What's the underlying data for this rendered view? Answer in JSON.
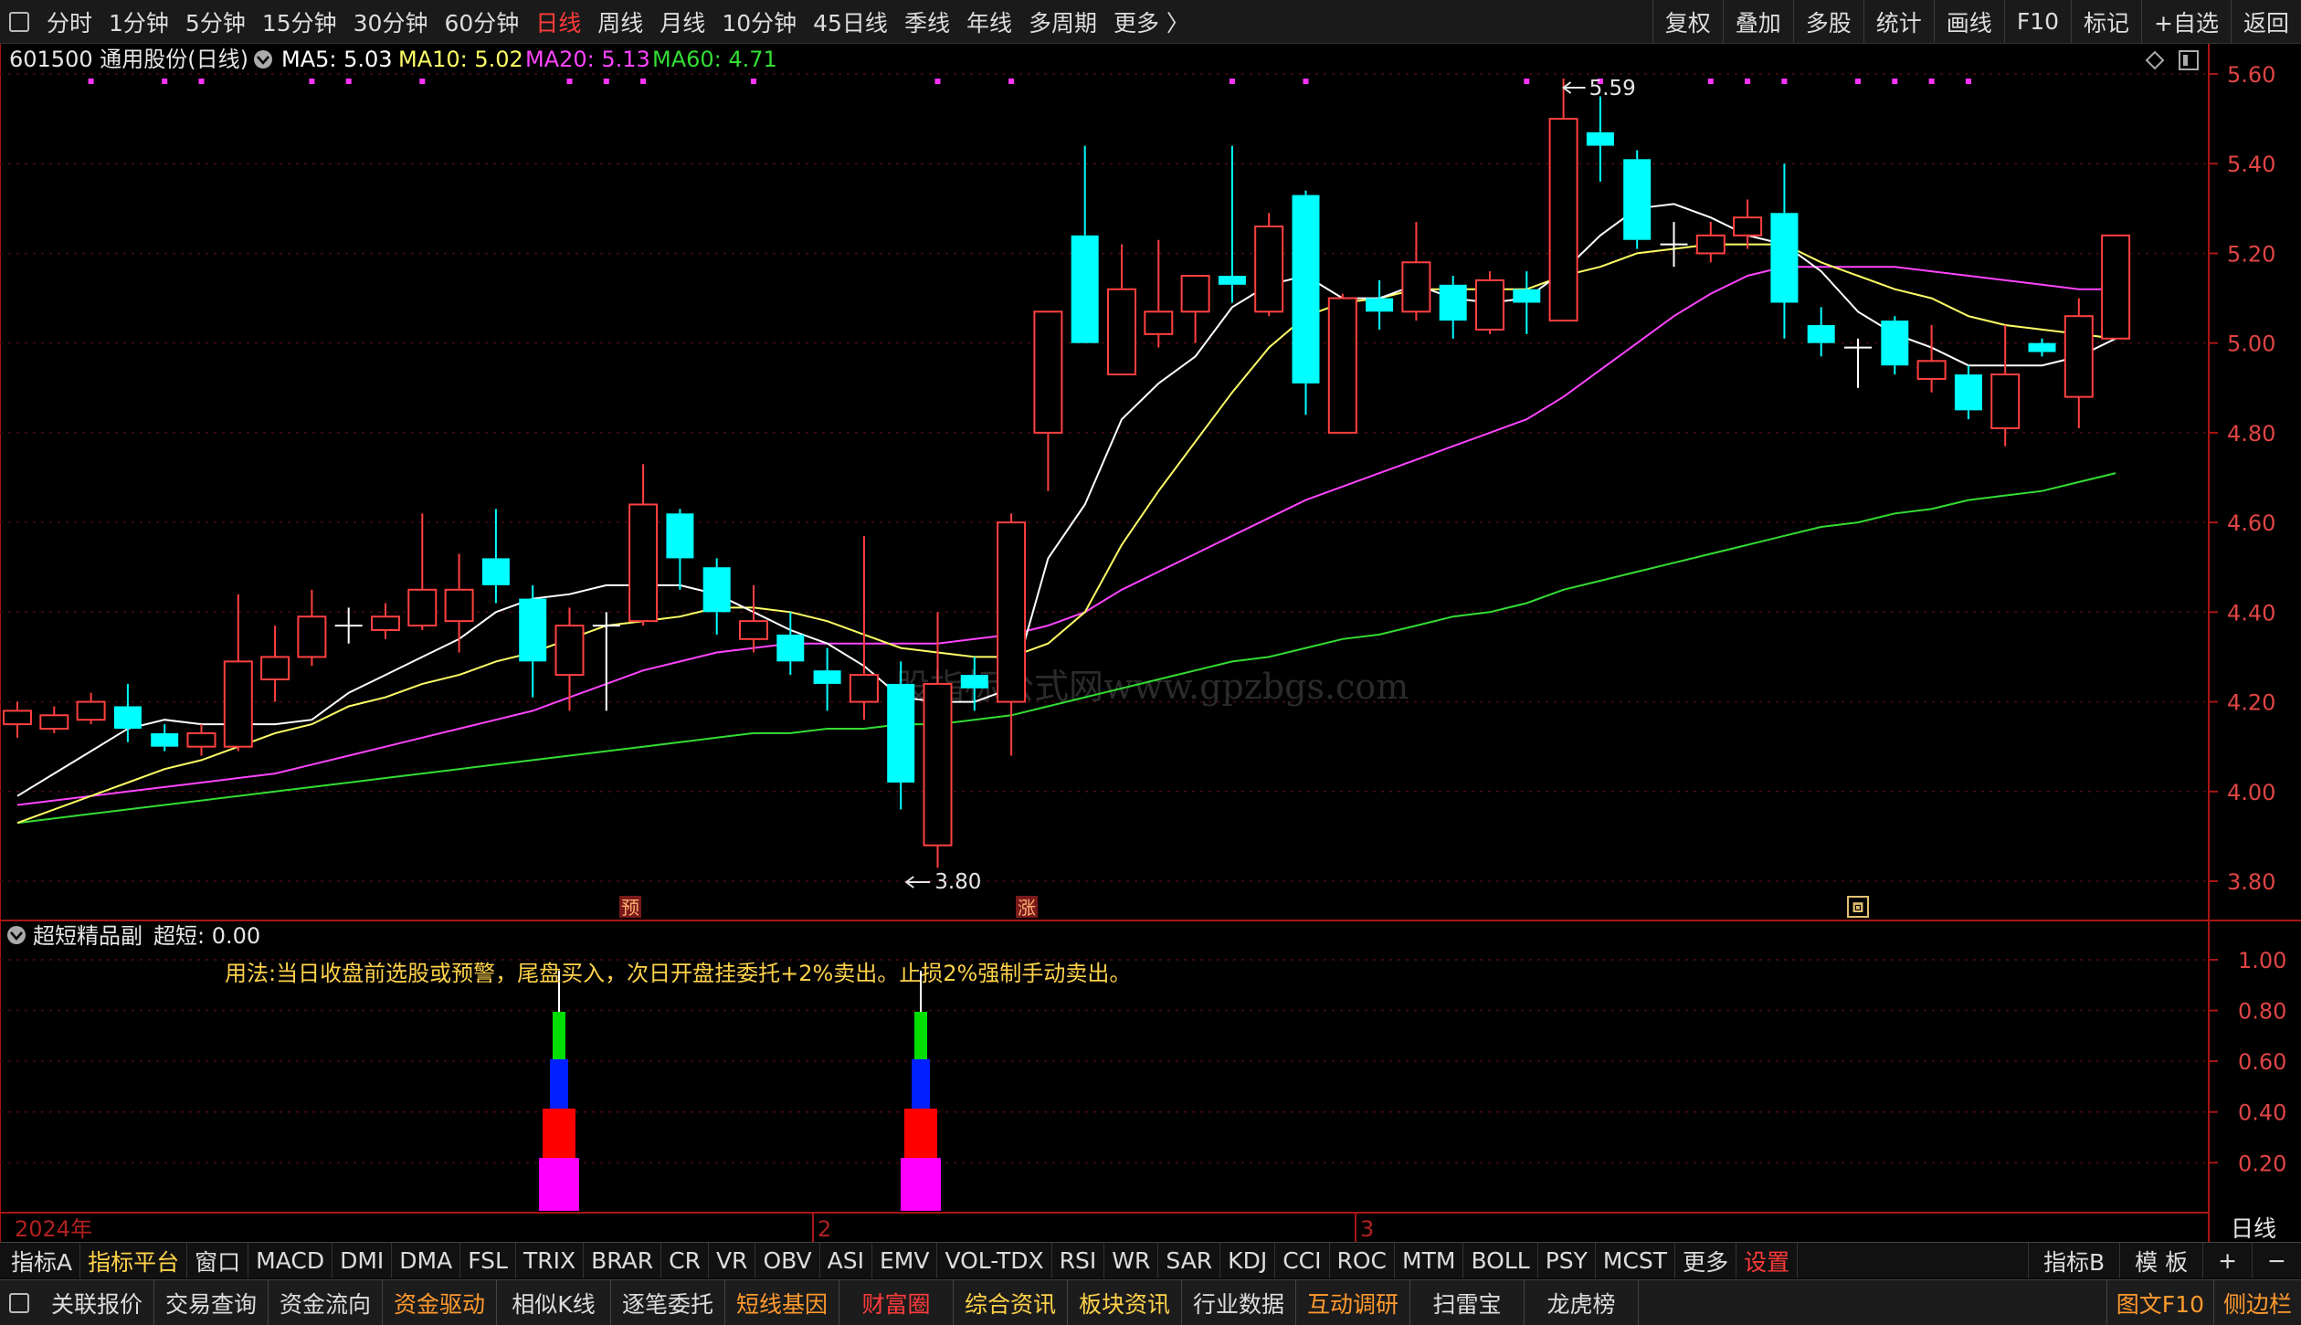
{
  "top_menu": {
    "periods": [
      "分时",
      "1分钟",
      "5分钟",
      "15分钟",
      "30分钟",
      "60分钟",
      "日线",
      "周线",
      "月线",
      "10分钟",
      "45日线",
      "季线",
      "年线",
      "多周期",
      "更多 〉"
    ],
    "active_period": "日线",
    "right_buttons": [
      "复权",
      "叠加",
      "多股",
      "统计",
      "画线",
      "F10",
      "标记",
      "+自选",
      "返回"
    ]
  },
  "stock": {
    "title": "601500 通用股份(日线)",
    "ma5": "MA5: 5.03",
    "ma10": "MA10: 5.02",
    "ma20": "MA20: 5.13",
    "ma60": "MA60: 4.71"
  },
  "colors": {
    "up": "#ff4040",
    "down": "#00ffff",
    "ma5": "#ffffff",
    "ma10": "#ffff66",
    "ma20": "#ff44ff",
    "ma60": "#33dd33",
    "axis": "#aa1515",
    "label": "#e04444",
    "notice": "#ffd24a"
  },
  "chart_data": {
    "type": "candlestick",
    "x_label": "2024年",
    "month_labels": [
      "2",
      "3"
    ],
    "price_axis": {
      "min": 3.8,
      "max": 5.6,
      "ticks": [
        "5.60",
        "5.40",
        "5.20",
        "5.00",
        "4.80",
        "4.60",
        "4.40",
        "4.20",
        "4.00",
        "3.80"
      ]
    },
    "high_label": "5.59",
    "low_label": "3.80",
    "markers": [
      "预",
      "涨",
      "回"
    ],
    "candles": [
      {
        "o": 4.15,
        "c": 4.18,
        "h": 4.2,
        "l": 4.12
      },
      {
        "o": 4.14,
        "c": 4.17,
        "h": 4.19,
        "l": 4.13
      },
      {
        "o": 4.16,
        "c": 4.2,
        "h": 4.22,
        "l": 4.15
      },
      {
        "o": 4.19,
        "c": 4.14,
        "h": 4.24,
        "l": 4.11
      },
      {
        "o": 4.13,
        "c": 4.1,
        "h": 4.15,
        "l": 4.09
      },
      {
        "o": 4.1,
        "c": 4.13,
        "h": 4.15,
        "l": 4.08
      },
      {
        "o": 4.1,
        "c": 4.29,
        "h": 4.44,
        "l": 4.09
      },
      {
        "o": 4.25,
        "c": 4.3,
        "h": 4.37,
        "l": 4.2
      },
      {
        "o": 4.3,
        "c": 4.39,
        "h": 4.45,
        "l": 4.28
      },
      {
        "o": 4.37,
        "c": 4.37,
        "h": 4.41,
        "l": 4.33
      },
      {
        "o": 4.36,
        "c": 4.39,
        "h": 4.42,
        "l": 4.34
      },
      {
        "o": 4.37,
        "c": 4.45,
        "h": 4.62,
        "l": 4.36
      },
      {
        "o": 4.38,
        "c": 4.45,
        "h": 4.53,
        "l": 4.31
      },
      {
        "o": 4.52,
        "c": 4.46,
        "h": 4.63,
        "l": 4.42
      },
      {
        "o": 4.43,
        "c": 4.29,
        "h": 4.46,
        "l": 4.21
      },
      {
        "o": 4.26,
        "c": 4.37,
        "h": 4.41,
        "l": 4.18
      },
      {
        "o": 4.37,
        "c": 4.37,
        "h": 4.4,
        "l": 4.18
      },
      {
        "o": 4.38,
        "c": 4.64,
        "h": 4.73,
        "l": 4.37
      },
      {
        "o": 4.62,
        "c": 4.52,
        "h": 4.63,
        "l": 4.45
      },
      {
        "o": 4.5,
        "c": 4.4,
        "h": 4.52,
        "l": 4.35
      },
      {
        "o": 4.34,
        "c": 4.38,
        "h": 4.46,
        "l": 4.31
      },
      {
        "o": 4.35,
        "c": 4.29,
        "h": 4.4,
        "l": 4.26
      },
      {
        "o": 4.27,
        "c": 4.24,
        "h": 4.32,
        "l": 4.18
      },
      {
        "o": 4.2,
        "c": 4.26,
        "h": 4.57,
        "l": 4.16
      },
      {
        "o": 4.24,
        "c": 4.02,
        "h": 4.29,
        "l": 3.96
      },
      {
        "o": 3.88,
        "c": 4.24,
        "h": 4.4,
        "l": 3.83
      },
      {
        "o": 4.26,
        "c": 4.23,
        "h": 4.3,
        "l": 4.18
      },
      {
        "o": 4.2,
        "c": 4.6,
        "h": 4.62,
        "l": 4.08
      },
      {
        "o": 4.8,
        "c": 5.07,
        "h": 5.07,
        "l": 4.67
      },
      {
        "o": 5.24,
        "c": 5.0,
        "h": 5.44,
        "l": 5.0
      },
      {
        "o": 4.93,
        "c": 5.12,
        "h": 5.22,
        "l": 4.93
      },
      {
        "o": 5.02,
        "c": 5.07,
        "h": 5.23,
        "l": 4.99
      },
      {
        "o": 5.07,
        "c": 5.15,
        "h": 5.15,
        "l": 5.0
      },
      {
        "o": 5.15,
        "c": 5.13,
        "h": 5.44,
        "l": 5.09
      },
      {
        "o": 5.07,
        "c": 5.26,
        "h": 5.29,
        "l": 5.06
      },
      {
        "o": 5.33,
        "c": 4.91,
        "h": 5.34,
        "l": 4.84
      },
      {
        "o": 4.8,
        "c": 5.1,
        "h": 5.11,
        "l": 4.8
      },
      {
        "o": 5.1,
        "c": 5.07,
        "h": 5.14,
        "l": 5.03
      },
      {
        "o": 5.07,
        "c": 5.18,
        "h": 5.27,
        "l": 5.05
      },
      {
        "o": 5.13,
        "c": 5.05,
        "h": 5.15,
        "l": 5.01
      },
      {
        "o": 5.03,
        "c": 5.14,
        "h": 5.16,
        "l": 5.02
      },
      {
        "o": 5.12,
        "c": 5.09,
        "h": 5.16,
        "l": 5.02
      },
      {
        "o": 5.05,
        "c": 5.5,
        "h": 5.59,
        "l": 5.05
      },
      {
        "o": 5.47,
        "c": 5.44,
        "h": 5.55,
        "l": 5.36
      },
      {
        "o": 5.41,
        "c": 5.23,
        "h": 5.43,
        "l": 5.21
      },
      {
        "o": 5.22,
        "c": 5.22,
        "h": 5.27,
        "l": 5.17
      },
      {
        "o": 5.2,
        "c": 5.24,
        "h": 5.27,
        "l": 5.18
      },
      {
        "o": 5.24,
        "c": 5.28,
        "h": 5.32,
        "l": 5.21
      },
      {
        "o": 5.29,
        "c": 5.09,
        "h": 5.4,
        "l": 5.01
      },
      {
        "o": 5.04,
        "c": 5.0,
        "h": 5.08,
        "l": 4.97
      },
      {
        "o": 4.99,
        "c": 4.99,
        "h": 5.01,
        "l": 4.9
      },
      {
        "o": 5.05,
        "c": 4.95,
        "h": 5.06,
        "l": 4.93
      },
      {
        "o": 4.92,
        "c": 4.96,
        "h": 5.04,
        "l": 4.89
      },
      {
        "o": 4.93,
        "c": 4.85,
        "h": 4.95,
        "l": 4.83
      },
      {
        "o": 4.81,
        "c": 4.93,
        "h": 5.04,
        "l": 4.77
      },
      {
        "o": 5.0,
        "c": 4.98,
        "h": 5.01,
        "l": 4.97
      },
      {
        "o": 4.88,
        "c": 5.06,
        "h": 5.1,
        "l": 4.81
      },
      {
        "o": 5.01,
        "c": 5.24,
        "h": 5.24,
        "l": 5.01
      }
    ],
    "ma5_values": [
      3.99,
      4.04,
      4.09,
      4.14,
      4.16,
      4.15,
      4.15,
      4.15,
      4.16,
      4.22,
      4.26,
      4.3,
      4.34,
      4.4,
      4.43,
      4.44,
      4.46,
      4.46,
      4.46,
      4.44,
      4.4,
      4.36,
      4.33,
      4.28,
      4.21,
      4.2,
      4.2,
      4.23,
      4.52,
      4.64,
      4.83,
      4.91,
      4.97,
      5.08,
      5.13,
      5.15,
      5.1,
      5.1,
      5.13,
      5.1,
      5.09,
      5.1,
      5.16,
      5.24,
      5.3,
      5.31,
      5.28,
      5.24,
      5.22,
      5.16,
      5.07,
      5.02,
      4.99,
      4.95,
      4.95,
      4.95,
      4.97,
      5.01
    ],
    "ma10_values": [
      3.93,
      3.96,
      3.99,
      4.02,
      4.05,
      4.07,
      4.1,
      4.13,
      4.15,
      4.19,
      4.21,
      4.24,
      4.26,
      4.29,
      4.31,
      4.34,
      4.37,
      4.38,
      4.39,
      4.41,
      4.41,
      4.4,
      4.38,
      4.35,
      4.32,
      4.31,
      4.3,
      4.3,
      4.33,
      4.4,
      4.55,
      4.67,
      4.78,
      4.89,
      4.99,
      5.06,
      5.09,
      5.1,
      5.12,
      5.12,
      5.12,
      5.12,
      5.15,
      5.17,
      5.2,
      5.21,
      5.22,
      5.22,
      5.22,
      5.18,
      5.15,
      5.12,
      5.1,
      5.06,
      5.04,
      5.03,
      5.02,
      5.01
    ],
    "ma20_values": [
      3.97,
      3.98,
      3.99,
      4.0,
      4.01,
      4.02,
      4.03,
      4.04,
      4.06,
      4.08,
      4.1,
      4.12,
      4.14,
      4.16,
      4.18,
      4.21,
      4.24,
      4.27,
      4.29,
      4.31,
      4.32,
      4.33,
      4.33,
      4.33,
      4.33,
      4.33,
      4.34,
      4.35,
      4.37,
      4.4,
      4.45,
      4.49,
      4.53,
      4.57,
      4.61,
      4.65,
      4.68,
      4.71,
      4.74,
      4.77,
      4.8,
      4.83,
      4.88,
      4.94,
      5.0,
      5.06,
      5.11,
      5.15,
      5.17,
      5.17,
      5.17,
      5.17,
      5.16,
      5.15,
      5.14,
      5.13,
      5.12,
      5.12
    ],
    "ma60_values": [
      3.93,
      3.94,
      3.95,
      3.96,
      3.97,
      3.98,
      3.99,
      4.0,
      4.01,
      4.02,
      4.03,
      4.04,
      4.05,
      4.06,
      4.07,
      4.08,
      4.09,
      4.1,
      4.11,
      4.12,
      4.13,
      4.13,
      4.14,
      4.14,
      4.15,
      4.15,
      4.16,
      4.17,
      4.19,
      4.21,
      4.23,
      4.25,
      4.27,
      4.29,
      4.3,
      4.32,
      4.34,
      4.35,
      4.37,
      4.39,
      4.4,
      4.42,
      4.45,
      4.47,
      4.49,
      4.51,
      4.53,
      4.55,
      4.57,
      4.59,
      4.6,
      4.62,
      4.63,
      4.65,
      4.66,
      4.67,
      4.69,
      4.71
    ],
    "top_dot_indices": [
      2,
      4,
      5,
      8,
      9,
      11,
      15,
      16,
      17,
      20,
      25,
      27,
      33,
      35,
      41,
      43,
      46,
      47,
      48,
      50,
      51,
      52,
      53
    ]
  },
  "sub_indicator": {
    "title": "超短精品副",
    "value": "超短: 0.00",
    "notice": "用法:当日收盘前选股或预警，尾盘买入，次日开盘挂委托+2%卖出。止损2%强制手动卖出。",
    "axis_ticks": [
      "1.00",
      "0.80",
      "0.60",
      "0.40",
      "0.20"
    ],
    "signal_indices": [
      15,
      25
    ],
    "period_label": "日线"
  },
  "indicator_tabs": [
    "指标A",
    "指标平台",
    "窗口",
    "MACD",
    "DMI",
    "DMA",
    "FSL",
    "TRIX",
    "BRAR",
    "CR",
    "VR",
    "OBV",
    "ASI",
    "EMV",
    "VOL-TDX",
    "RSI",
    "WR",
    "SAR",
    "KDJ",
    "CCI",
    "ROC",
    "MTM",
    "BOLL",
    "PSY",
    "MCST",
    "更多",
    "设置"
  ],
  "indicator_tabs_right": [
    "指标B",
    "模 板",
    "+",
    "−"
  ],
  "bottom_buttons": [
    "关联报价",
    "交易查询",
    "资金流向",
    "资金驱动",
    "相似K线",
    "逐笔委托",
    "短线基因",
    "财富圈",
    "综合资讯",
    "板块资讯",
    "行业数据",
    "互动调研",
    "扫雷宝",
    "龙虎榜"
  ],
  "bottom_buttons_right": [
    "图文F10",
    "侧边栏"
  ]
}
